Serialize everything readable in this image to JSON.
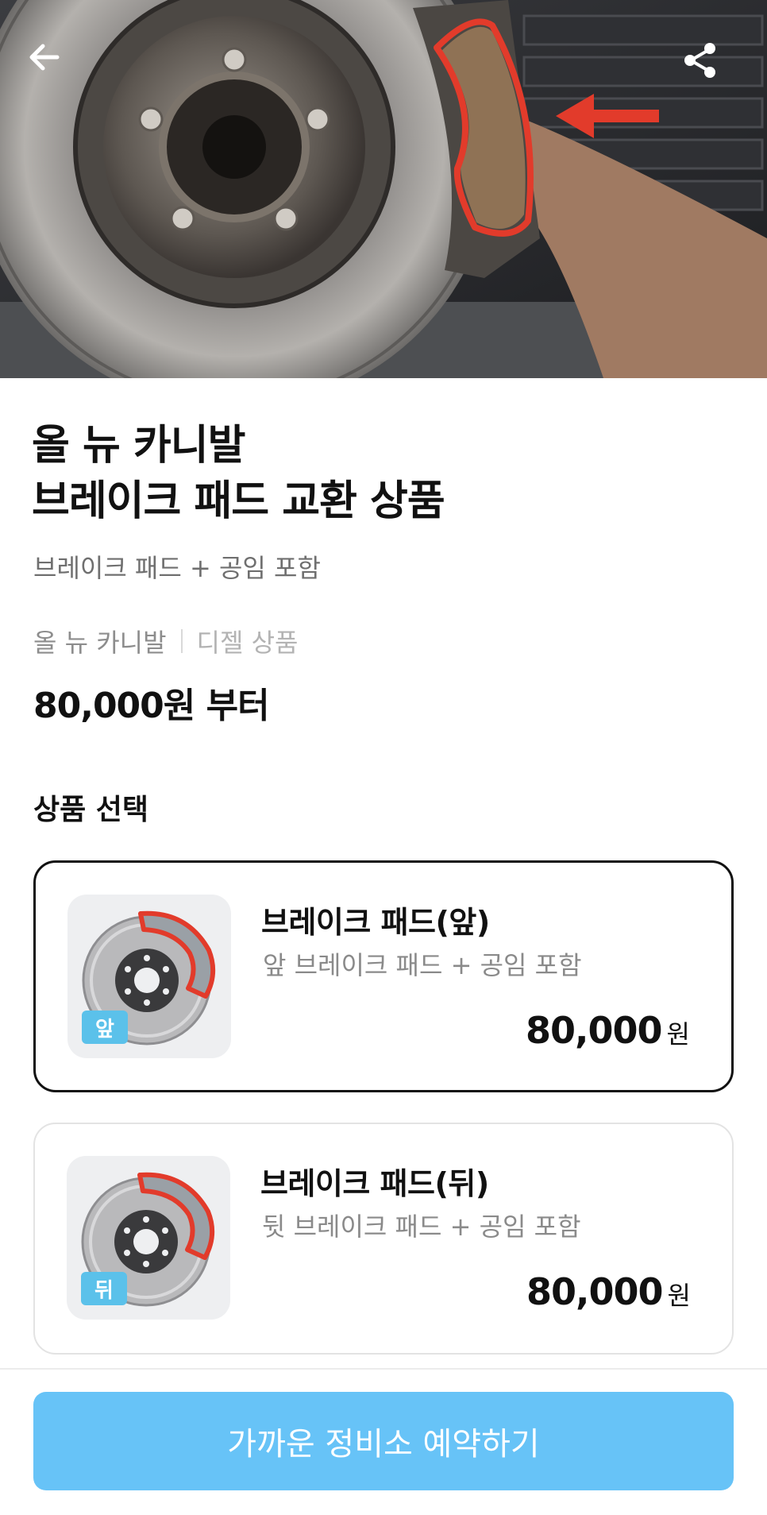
{
  "hero": {
    "back_icon": "arrow-left-icon",
    "share_icon": "share-icon",
    "image": "brake-disc-pad-photo",
    "highlight_color": "#e23b2b"
  },
  "product": {
    "title_line1": "올 뉴 카니발",
    "title_line2": "브레이크 패드 교환 상품",
    "subtitle": "브레이크 패드 + 공임 포함",
    "model": "올 뉴 카니발",
    "fuel_type": "디젤 상품",
    "price_from": "80,000원 부터"
  },
  "selection": {
    "title": "상품 선택",
    "options": [
      {
        "name": "브레이크 패드(앞)",
        "description": "앞 브레이크 패드 + 공임 포함",
        "badge": "앞",
        "price": "80,000",
        "unit": "원",
        "selected": true
      },
      {
        "name": "브레이크 패드(뒤)",
        "description": "뒷 브레이크 패드 + 공임 포함",
        "badge": "뒤",
        "price": "80,000",
        "unit": "원",
        "selected": false
      }
    ]
  },
  "cta": {
    "label": "가까운 정비소 예약하기",
    "color": "#67c3f7"
  }
}
